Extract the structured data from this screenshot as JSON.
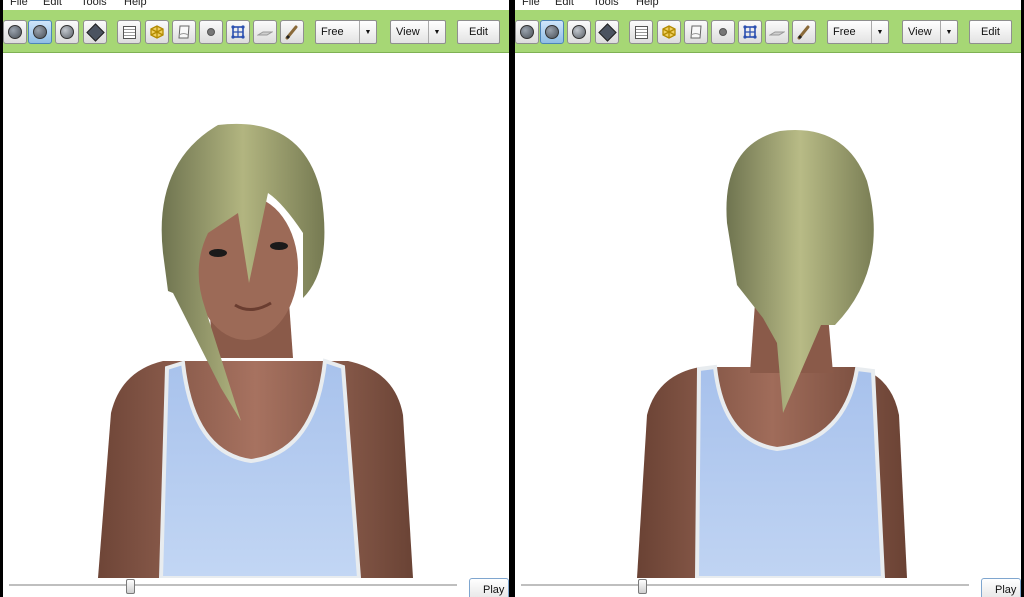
{
  "menus": [
    "File",
    "Edit",
    "Tools",
    "Help"
  ],
  "toolbar": {
    "tool_icons": [
      "shaded-sphere-icon",
      "smooth-sphere-icon",
      "dark-sphere-icon",
      "diamond-icon",
      "wireframe-icon",
      "skeleton-icon",
      "texture-icon",
      "point-icon",
      "bone-grid-icon",
      "floor-icon",
      "pen-icon"
    ],
    "camera_mode": "Free",
    "view_label": "View",
    "edit_label": "Edit"
  },
  "playback": {
    "play_label": "Play",
    "position": 0.27
  },
  "viewports": [
    "front",
    "back"
  ],
  "colors": {
    "toolbar_bg": "#a6d775",
    "hair": "#9b9f6b",
    "tank_top": "#b7cdf0",
    "skin": "#9c6a57"
  }
}
